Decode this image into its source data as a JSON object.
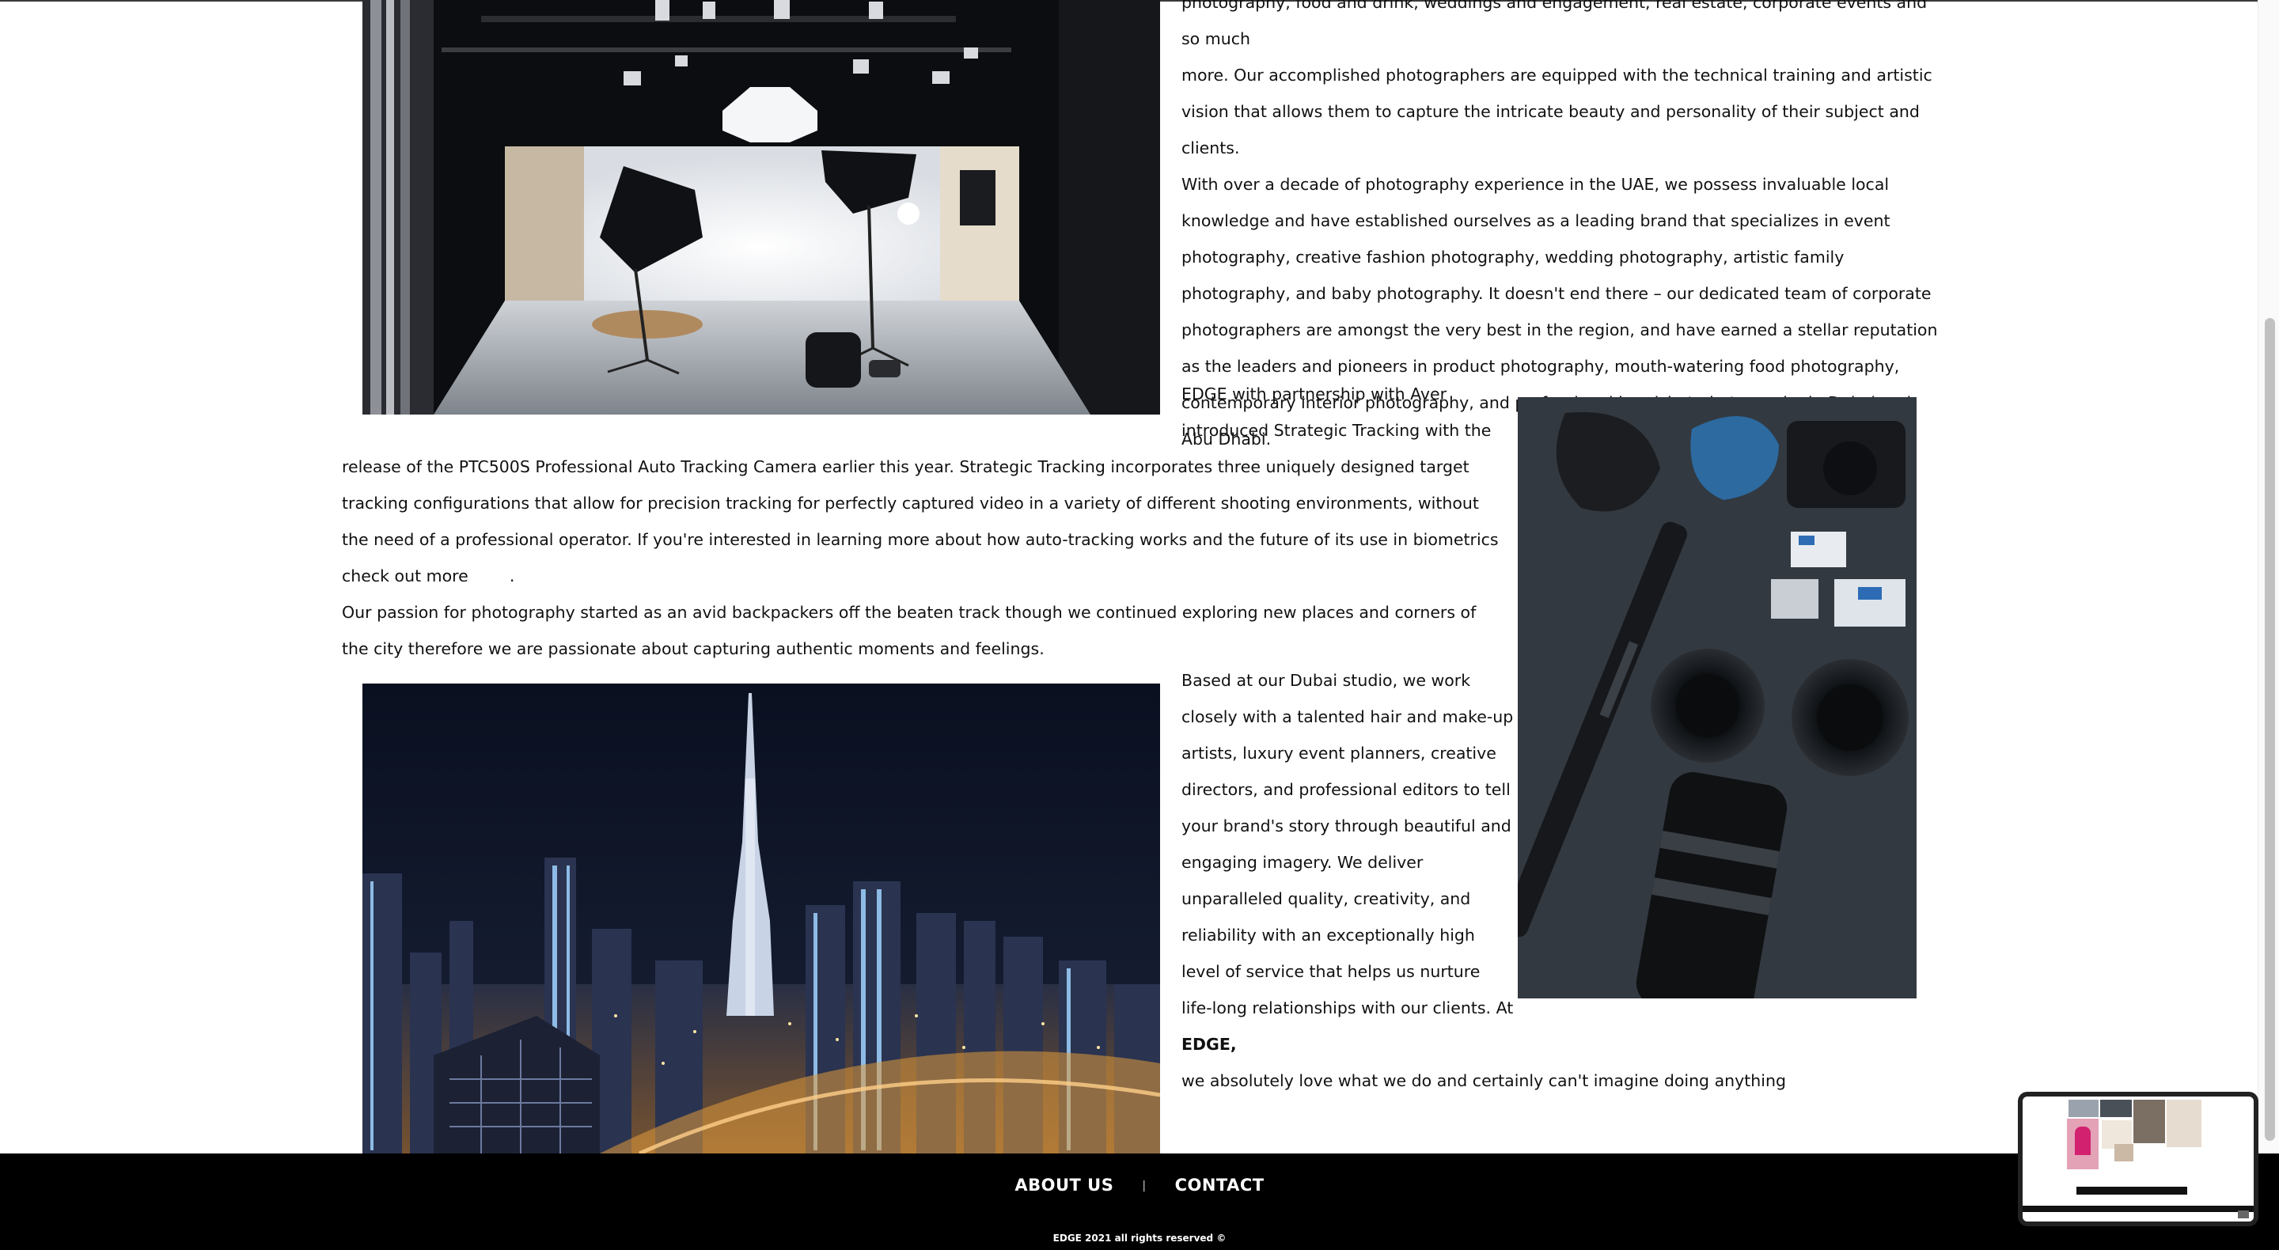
{
  "article": {
    "para1_line0": "photography, food and drink, weddings and engagement, real estate, corporate events and so much",
    "para1_rest": "more. Our accomplished photographers are equipped with the technical training and artistic vision that allows them to capture the intricate beauty and personality of their subject and clients.",
    "para2": "With over a decade of photography experience in the UAE, we possess invaluable local knowledge and have established ourselves as a leading brand that specializes in event photography, creative fashion photography, wedding photography, artistic family photography, and baby photography. It doesn't end there – our dedicated team of corporate photographers are amongst the very best in the region, and have earned a stellar reputation as the leaders and pioneers in product photography, mouth-watering food photography, contemporary interior photography, and professional headshot photography in Dubai and Abu Dhabi.",
    "para3_line1": "EDGE with partnership with Aver",
    "para3_line2": "introduced Strategic Tracking with the",
    "para3_rest": "release of the PTC500S Professional Auto Tracking Camera earlier this year. Strategic Tracking incorporates three uniquely designed target tracking configurations that allow for precision tracking for perfectly captured video in a variety of different shooting environments, without the need of a professional operator. If you're interested in learning more about how auto-tracking works and the future of its use in biometrics check out more",
    "para3_end": ".",
    "para4": "Our passion for photography started as an avid backpackers off the beaten track though we continued exploring new places and corners of the city therefore we are passionate about capturing authentic moments and feelings.",
    "para5_pre": "Based at our Dubai studio, we work closely with a talented hair and make-up artists, luxury event planners, creative directors, and professional editors to tell your brand's story through beautiful and engaging imagery. We deliver unparalleled quality, creativity, and reliability with an exceptionally high level of service that helps us nurture life-long relationships with our clients. At",
    "para5_brand": "EDGE,",
    "para5_post": "we absolutely love what we do and certainly can't imagine doing anything"
  },
  "images": {
    "studio_alt": "photo studio with softbox lights",
    "gear_alt": "camera lenses and tripod on table",
    "city_alt": "Dubai skyline at night"
  },
  "footer": {
    "about_label": "ABOUT US",
    "separator": "|",
    "contact_label": "CONTACT",
    "copyright": "EDGE 2021 all rights reserved ©"
  },
  "colors": {
    "footer_bg": "#000000",
    "text": "#111111",
    "background": "#ffffff"
  },
  "icons": {
    "preview": "floating-page-preview"
  }
}
